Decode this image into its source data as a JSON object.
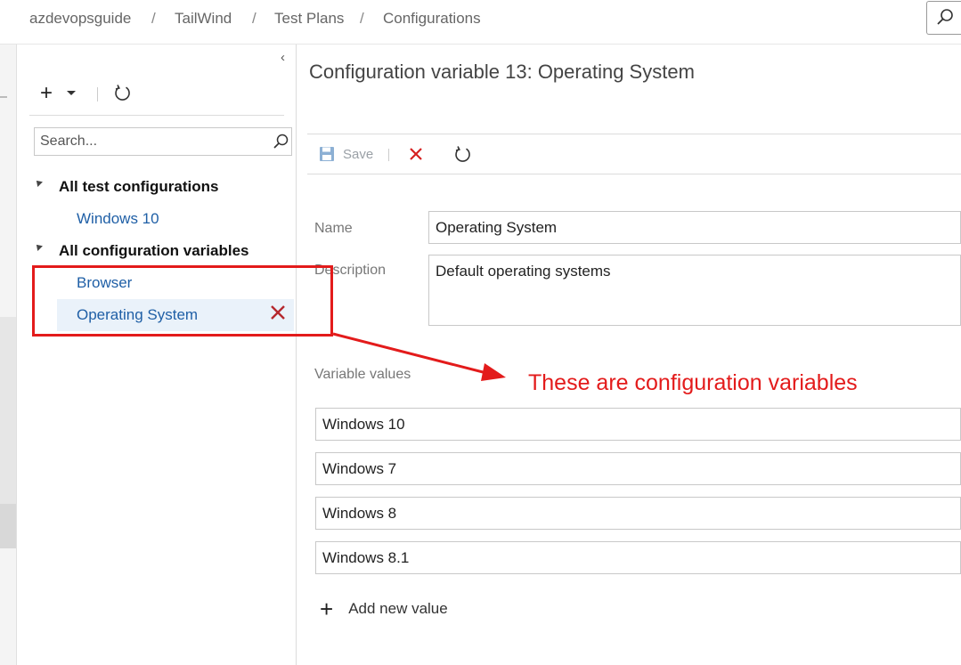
{
  "breadcrumb": {
    "items": [
      "azdevopsguide",
      "TailWind",
      "Test Plans",
      "Configurations"
    ],
    "separator": "/"
  },
  "left_panel": {
    "toolbar": {
      "add_icon": "plus-icon",
      "dropdown_icon": "caret-down-icon",
      "refresh_icon": "refresh-icon"
    },
    "search": {
      "placeholder": "Search...",
      "icon": "search-icon"
    },
    "tree": {
      "group1": {
        "label": "All test configurations",
        "items": [
          "Windows 10"
        ]
      },
      "group2": {
        "label": "All configuration variables",
        "items": [
          "Browser",
          "Operating System"
        ]
      }
    }
  },
  "detail": {
    "title": "Configuration variable 13: Operating System",
    "toolbar": {
      "save_label": "Save"
    },
    "name_label": "Name",
    "name_value": "Operating System",
    "description_label": "Description",
    "description_value": "Default operating systems",
    "variable_values_label": "Variable values",
    "variable_values": [
      "Windows 10",
      "Windows 7",
      "Windows 8",
      "Windows 8.1"
    ],
    "add_new_label": "Add new value"
  },
  "annotation": {
    "text": "These are configuration variables"
  },
  "colors": {
    "link": "#1f5fa6",
    "annotation": "#e31b1b",
    "selected_bg": "#eaf2fa"
  }
}
